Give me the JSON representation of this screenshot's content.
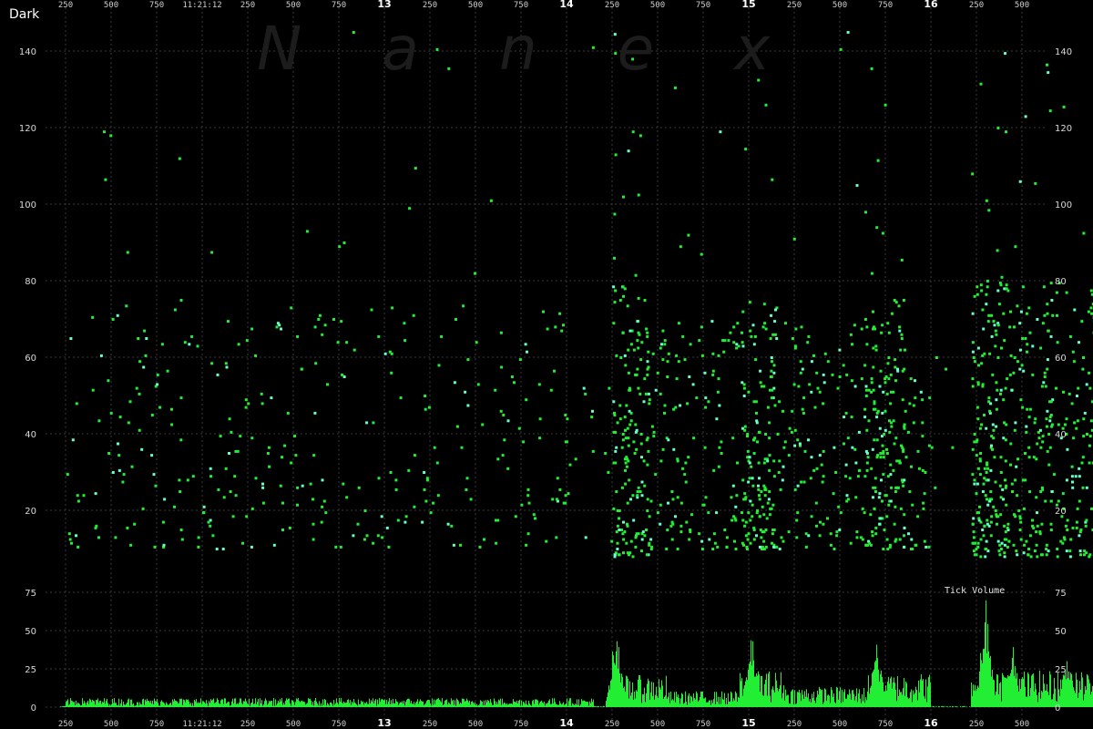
{
  "chart_data": [
    {
      "type": "scatter",
      "title": "Dark",
      "watermark": "Nanex",
      "ylim": [
        4,
        148
      ],
      "yticks": [
        20,
        40,
        60,
        80,
        100,
        120,
        140
      ],
      "x_sequence_ms": [
        250,
        500,
        750,
        1000,
        1250,
        1500,
        1750,
        2000,
        2250,
        2500,
        2750,
        3000,
        3250,
        3500,
        3750,
        4000,
        4250,
        4500,
        4750,
        5000,
        5250,
        5500,
        5750,
        6000,
        6250,
        6500
      ],
      "x_tick_labels": [
        "250",
        "500",
        "750",
        "11:21:12",
        "250",
        "500",
        "750",
        "13",
        "250",
        "500",
        "750",
        "14",
        "250",
        "500",
        "750",
        "15",
        "250",
        "500",
        "750",
        "16",
        "250",
        "500"
      ],
      "x_bold_ticks": [
        "13",
        "14",
        "15",
        "16"
      ],
      "grid": true,
      "colors": {
        "point": "#22ee33",
        "point_alt": "#66ffcc",
        "grid": "#3a3a3a",
        "background": "#000000"
      },
      "density_profile": [
        {
          "from_ms": 0,
          "to_ms": 2750,
          "points_per_250ms": 30,
          "y_range": [
            10,
            75
          ]
        },
        {
          "from_ms": 2750,
          "to_ms": 3000,
          "points_per_250ms": 14,
          "y_range": [
            10,
            60
          ]
        },
        {
          "from_ms": 3000,
          "to_ms": 3200,
          "points_per_250ms": 220,
          "y_range": [
            8,
            80
          ]
        },
        {
          "from_ms": 3200,
          "to_ms": 3700,
          "points_per_250ms": 70,
          "y_range": [
            10,
            70
          ]
        },
        {
          "from_ms": 3700,
          "to_ms": 3900,
          "points_per_250ms": 200,
          "y_range": [
            10,
            75
          ]
        },
        {
          "from_ms": 3900,
          "to_ms": 4380,
          "points_per_250ms": 70,
          "y_range": [
            10,
            70
          ]
        },
        {
          "from_ms": 4380,
          "to_ms": 4600,
          "points_per_250ms": 210,
          "y_range": [
            10,
            75
          ]
        },
        {
          "from_ms": 4600,
          "to_ms": 4750,
          "points_per_250ms": 60,
          "y_range": [
            10,
            55
          ]
        },
        {
          "from_ms": 4750,
          "to_ms": 4970,
          "points_per_250ms": 5,
          "y_range": [
            10,
            70
          ]
        },
        {
          "from_ms": 4970,
          "to_ms": 5160,
          "points_per_250ms": 260,
          "y_range": [
            8,
            80
          ]
        },
        {
          "from_ms": 5160,
          "to_ms": 5650,
          "points_per_250ms": 140,
          "y_range": [
            8,
            80
          ]
        }
      ]
    },
    {
      "type": "bar",
      "title": "Tick Volume",
      "ylim": [
        0,
        75
      ],
      "yticks": [
        0,
        25,
        50,
        75
      ],
      "color": "#22ee33",
      "peaks": [
        {
          "at_ms": 3020,
          "value": 55
        },
        {
          "at_ms": 3765,
          "value": 48
        },
        {
          "at_ms": 4450,
          "value": 42
        },
        {
          "at_ms": 5050,
          "value": 72
        },
        {
          "at_ms": 5200,
          "value": 40
        },
        {
          "at_ms": 5500,
          "value": 37
        }
      ],
      "baseline_levels": [
        {
          "from_ms": 0,
          "to_ms": 2900,
          "value": 4
        },
        {
          "from_ms": 3000,
          "to_ms": 3300,
          "value": 14
        },
        {
          "from_ms": 3300,
          "to_ms": 3700,
          "value": 7
        },
        {
          "from_ms": 3700,
          "to_ms": 3950,
          "value": 16
        },
        {
          "from_ms": 3950,
          "to_ms": 4400,
          "value": 9
        },
        {
          "from_ms": 4400,
          "to_ms": 4750,
          "value": 15
        },
        {
          "from_ms": 4970,
          "to_ms": 5650,
          "value": 16
        }
      ]
    }
  ]
}
